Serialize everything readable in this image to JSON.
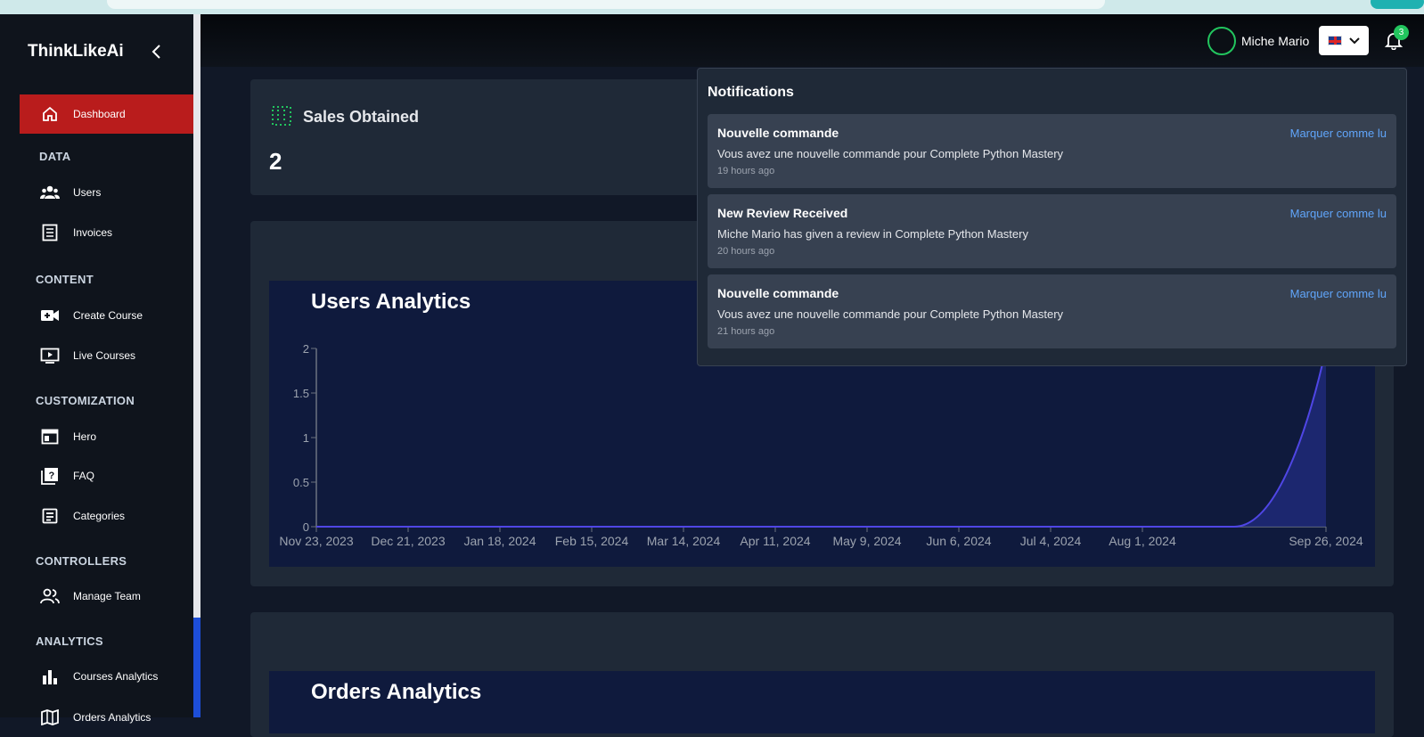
{
  "brand": "ThinkLikeAi",
  "sidebar": {
    "items": [
      {
        "label": "Dashboard",
        "icon": "home-icon"
      },
      {
        "label": "Users",
        "icon": "users-icon"
      },
      {
        "label": "Invoices",
        "icon": "invoice-icon"
      },
      {
        "label": "Create Course",
        "icon": "video-add-icon"
      },
      {
        "label": "Live Courses",
        "icon": "play-screen-icon"
      },
      {
        "label": "Hero",
        "icon": "web-layout-icon"
      },
      {
        "label": "FAQ",
        "icon": "faq-icon"
      },
      {
        "label": "Categories",
        "icon": "category-icon"
      },
      {
        "label": "Manage Team",
        "icon": "team-icon"
      },
      {
        "label": "Courses Analytics",
        "icon": "bar-chart-icon"
      },
      {
        "label": "Orders Analytics",
        "icon": "map-icon"
      }
    ],
    "sections": [
      "DATA",
      "CONTENT",
      "CUSTOMIZATION",
      "CONTROLLERS",
      "ANALYTICS"
    ]
  },
  "header": {
    "user_name": "Miche Mario",
    "notification_count": "3",
    "language_flag": "uk-flag-icon"
  },
  "sales": {
    "title": "Sales Obtained",
    "value": "2"
  },
  "users_chart_title": "Users Analytics",
  "orders_chart_title": "Orders Analytics",
  "notifications": {
    "title": "Notifications",
    "items": [
      {
        "title": "Nouvelle commande",
        "body": "Vous avez une nouvelle commande pour Complete Python Mastery",
        "time": "19 hours ago",
        "action": "Marquer comme lu"
      },
      {
        "title": "New Review Received",
        "body": "Miche Mario has given a review in Complete Python Mastery",
        "time": "20 hours ago",
        "action": "Marquer comme lu"
      },
      {
        "title": "Nouvelle commande",
        "body": "Vous avez une nouvelle commande pour Complete Python Mastery",
        "time": "21 hours ago",
        "action": "Marquer comme lu"
      }
    ]
  },
  "chart_data": {
    "type": "area",
    "title": "Users Analytics",
    "x_ticks": [
      "Nov 23, 2023",
      "Dec 21, 2023",
      "Jan 18, 2024",
      "Feb 15, 2024",
      "Mar 14, 2024",
      "Apr 11, 2024",
      "May 9, 2024",
      "Jun 6, 2024",
      "Jul 4, 2024",
      "Aug 1, 2024",
      "Sep 26, 2024"
    ],
    "y_ticks": [
      "0",
      "0.5",
      "1",
      "1.5",
      "2"
    ],
    "ylim": [
      0,
      2
    ],
    "x": [
      "Nov 23, 2023",
      "Dec 21, 2023",
      "Jan 18, 2024",
      "Feb 15, 2024",
      "Mar 14, 2024",
      "Apr 11, 2024",
      "May 9, 2024",
      "Jun 6, 2024",
      "Jul 4, 2024",
      "Aug 1, 2024",
      "Aug 29, 2024",
      "Sep 26, 2024"
    ],
    "y": [
      0,
      0,
      0,
      0,
      0,
      0,
      0,
      0,
      0,
      0,
      0,
      2
    ],
    "colors": {
      "line": "#4f46e5",
      "fill": "#1e2a78"
    }
  }
}
